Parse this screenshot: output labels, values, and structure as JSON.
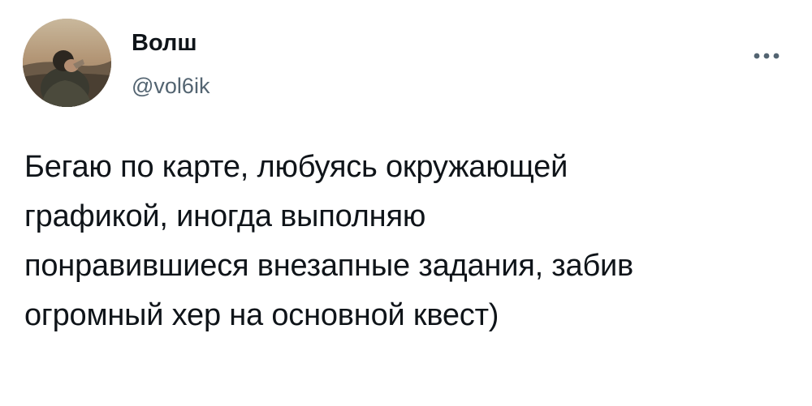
{
  "tweet": {
    "author": {
      "display_name": "Волш",
      "handle": "@vol6ik"
    },
    "more_icon": "more-horizontal-icon",
    "text": "Бегаю по карте, любуясь окружающей\nграфикой, иногда выполняю\nпонравившиеся внезапные задания, забив\nогромный хер на основной квест)"
  }
}
